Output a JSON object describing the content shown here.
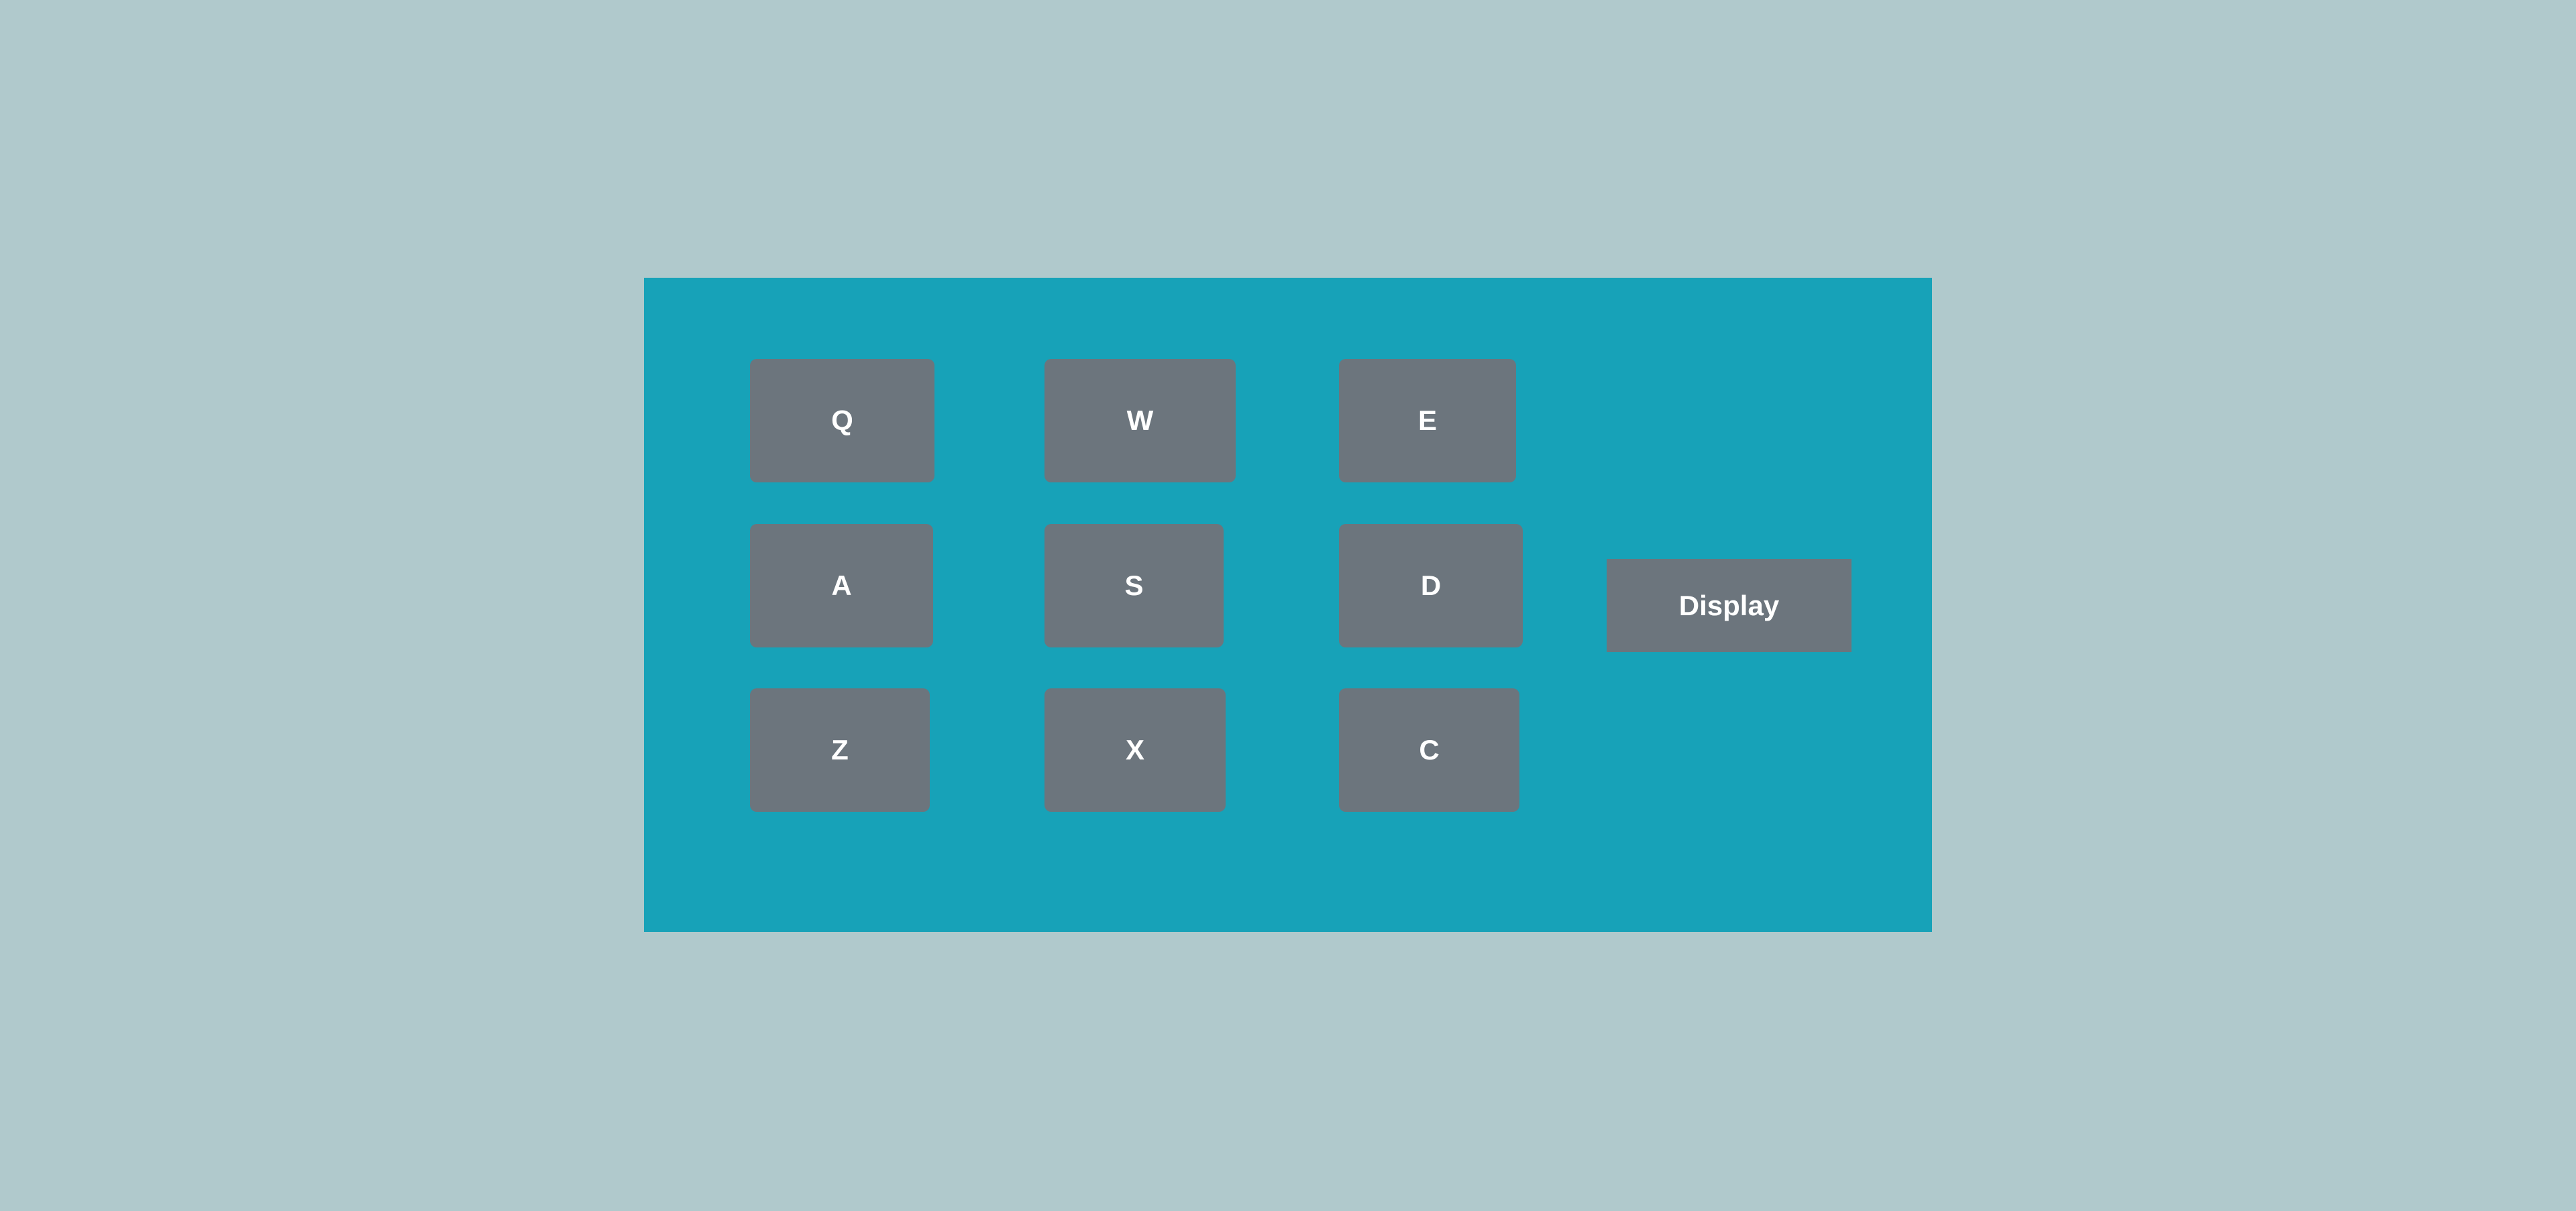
{
  "colors": {
    "background": "#b0c9cc",
    "panel": "#17a2b8",
    "button": "#6c757d",
    "text": "#ffffff"
  },
  "keys": [
    {
      "label": "Q"
    },
    {
      "label": "W"
    },
    {
      "label": "E"
    },
    {
      "label": "A"
    },
    {
      "label": "S"
    },
    {
      "label": "D"
    },
    {
      "label": "Z"
    },
    {
      "label": "X"
    },
    {
      "label": "C"
    }
  ],
  "display_button": {
    "label": "Display"
  }
}
